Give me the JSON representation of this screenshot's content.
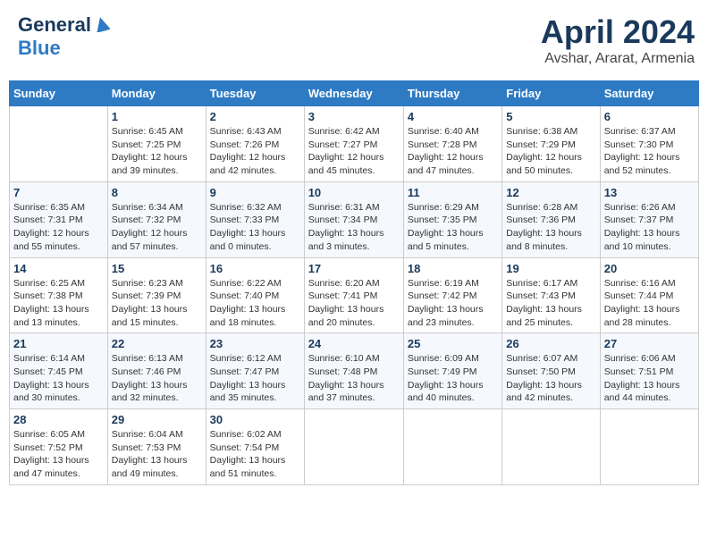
{
  "header": {
    "logo_general": "General",
    "logo_blue": "Blue",
    "title": "April 2024",
    "location": "Avshar, Ararat, Armenia"
  },
  "days_of_week": [
    "Sunday",
    "Monday",
    "Tuesday",
    "Wednesday",
    "Thursday",
    "Friday",
    "Saturday"
  ],
  "weeks": [
    [
      {
        "day": "",
        "sunrise": "",
        "sunset": "",
        "daylight": ""
      },
      {
        "day": "1",
        "sunrise": "Sunrise: 6:45 AM",
        "sunset": "Sunset: 7:25 PM",
        "daylight": "Daylight: 12 hours and 39 minutes."
      },
      {
        "day": "2",
        "sunrise": "Sunrise: 6:43 AM",
        "sunset": "Sunset: 7:26 PM",
        "daylight": "Daylight: 12 hours and 42 minutes."
      },
      {
        "day": "3",
        "sunrise": "Sunrise: 6:42 AM",
        "sunset": "Sunset: 7:27 PM",
        "daylight": "Daylight: 12 hours and 45 minutes."
      },
      {
        "day": "4",
        "sunrise": "Sunrise: 6:40 AM",
        "sunset": "Sunset: 7:28 PM",
        "daylight": "Daylight: 12 hours and 47 minutes."
      },
      {
        "day": "5",
        "sunrise": "Sunrise: 6:38 AM",
        "sunset": "Sunset: 7:29 PM",
        "daylight": "Daylight: 12 hours and 50 minutes."
      },
      {
        "day": "6",
        "sunrise": "Sunrise: 6:37 AM",
        "sunset": "Sunset: 7:30 PM",
        "daylight": "Daylight: 12 hours and 52 minutes."
      }
    ],
    [
      {
        "day": "7",
        "sunrise": "Sunrise: 6:35 AM",
        "sunset": "Sunset: 7:31 PM",
        "daylight": "Daylight: 12 hours and 55 minutes."
      },
      {
        "day": "8",
        "sunrise": "Sunrise: 6:34 AM",
        "sunset": "Sunset: 7:32 PM",
        "daylight": "Daylight: 12 hours and 57 minutes."
      },
      {
        "day": "9",
        "sunrise": "Sunrise: 6:32 AM",
        "sunset": "Sunset: 7:33 PM",
        "daylight": "Daylight: 13 hours and 0 minutes."
      },
      {
        "day": "10",
        "sunrise": "Sunrise: 6:31 AM",
        "sunset": "Sunset: 7:34 PM",
        "daylight": "Daylight: 13 hours and 3 minutes."
      },
      {
        "day": "11",
        "sunrise": "Sunrise: 6:29 AM",
        "sunset": "Sunset: 7:35 PM",
        "daylight": "Daylight: 13 hours and 5 minutes."
      },
      {
        "day": "12",
        "sunrise": "Sunrise: 6:28 AM",
        "sunset": "Sunset: 7:36 PM",
        "daylight": "Daylight: 13 hours and 8 minutes."
      },
      {
        "day": "13",
        "sunrise": "Sunrise: 6:26 AM",
        "sunset": "Sunset: 7:37 PM",
        "daylight": "Daylight: 13 hours and 10 minutes."
      }
    ],
    [
      {
        "day": "14",
        "sunrise": "Sunrise: 6:25 AM",
        "sunset": "Sunset: 7:38 PM",
        "daylight": "Daylight: 13 hours and 13 minutes."
      },
      {
        "day": "15",
        "sunrise": "Sunrise: 6:23 AM",
        "sunset": "Sunset: 7:39 PM",
        "daylight": "Daylight: 13 hours and 15 minutes."
      },
      {
        "day": "16",
        "sunrise": "Sunrise: 6:22 AM",
        "sunset": "Sunset: 7:40 PM",
        "daylight": "Daylight: 13 hours and 18 minutes."
      },
      {
        "day": "17",
        "sunrise": "Sunrise: 6:20 AM",
        "sunset": "Sunset: 7:41 PM",
        "daylight": "Daylight: 13 hours and 20 minutes."
      },
      {
        "day": "18",
        "sunrise": "Sunrise: 6:19 AM",
        "sunset": "Sunset: 7:42 PM",
        "daylight": "Daylight: 13 hours and 23 minutes."
      },
      {
        "day": "19",
        "sunrise": "Sunrise: 6:17 AM",
        "sunset": "Sunset: 7:43 PM",
        "daylight": "Daylight: 13 hours and 25 minutes."
      },
      {
        "day": "20",
        "sunrise": "Sunrise: 6:16 AM",
        "sunset": "Sunset: 7:44 PM",
        "daylight": "Daylight: 13 hours and 28 minutes."
      }
    ],
    [
      {
        "day": "21",
        "sunrise": "Sunrise: 6:14 AM",
        "sunset": "Sunset: 7:45 PM",
        "daylight": "Daylight: 13 hours and 30 minutes."
      },
      {
        "day": "22",
        "sunrise": "Sunrise: 6:13 AM",
        "sunset": "Sunset: 7:46 PM",
        "daylight": "Daylight: 13 hours and 32 minutes."
      },
      {
        "day": "23",
        "sunrise": "Sunrise: 6:12 AM",
        "sunset": "Sunset: 7:47 PM",
        "daylight": "Daylight: 13 hours and 35 minutes."
      },
      {
        "day": "24",
        "sunrise": "Sunrise: 6:10 AM",
        "sunset": "Sunset: 7:48 PM",
        "daylight": "Daylight: 13 hours and 37 minutes."
      },
      {
        "day": "25",
        "sunrise": "Sunrise: 6:09 AM",
        "sunset": "Sunset: 7:49 PM",
        "daylight": "Daylight: 13 hours and 40 minutes."
      },
      {
        "day": "26",
        "sunrise": "Sunrise: 6:07 AM",
        "sunset": "Sunset: 7:50 PM",
        "daylight": "Daylight: 13 hours and 42 minutes."
      },
      {
        "day": "27",
        "sunrise": "Sunrise: 6:06 AM",
        "sunset": "Sunset: 7:51 PM",
        "daylight": "Daylight: 13 hours and 44 minutes."
      }
    ],
    [
      {
        "day": "28",
        "sunrise": "Sunrise: 6:05 AM",
        "sunset": "Sunset: 7:52 PM",
        "daylight": "Daylight: 13 hours and 47 minutes."
      },
      {
        "day": "29",
        "sunrise": "Sunrise: 6:04 AM",
        "sunset": "Sunset: 7:53 PM",
        "daylight": "Daylight: 13 hours and 49 minutes."
      },
      {
        "day": "30",
        "sunrise": "Sunrise: 6:02 AM",
        "sunset": "Sunset: 7:54 PM",
        "daylight": "Daylight: 13 hours and 51 minutes."
      },
      {
        "day": "",
        "sunrise": "",
        "sunset": "",
        "daylight": ""
      },
      {
        "day": "",
        "sunrise": "",
        "sunset": "",
        "daylight": ""
      },
      {
        "day": "",
        "sunrise": "",
        "sunset": "",
        "daylight": ""
      },
      {
        "day": "",
        "sunrise": "",
        "sunset": "",
        "daylight": ""
      }
    ]
  ]
}
